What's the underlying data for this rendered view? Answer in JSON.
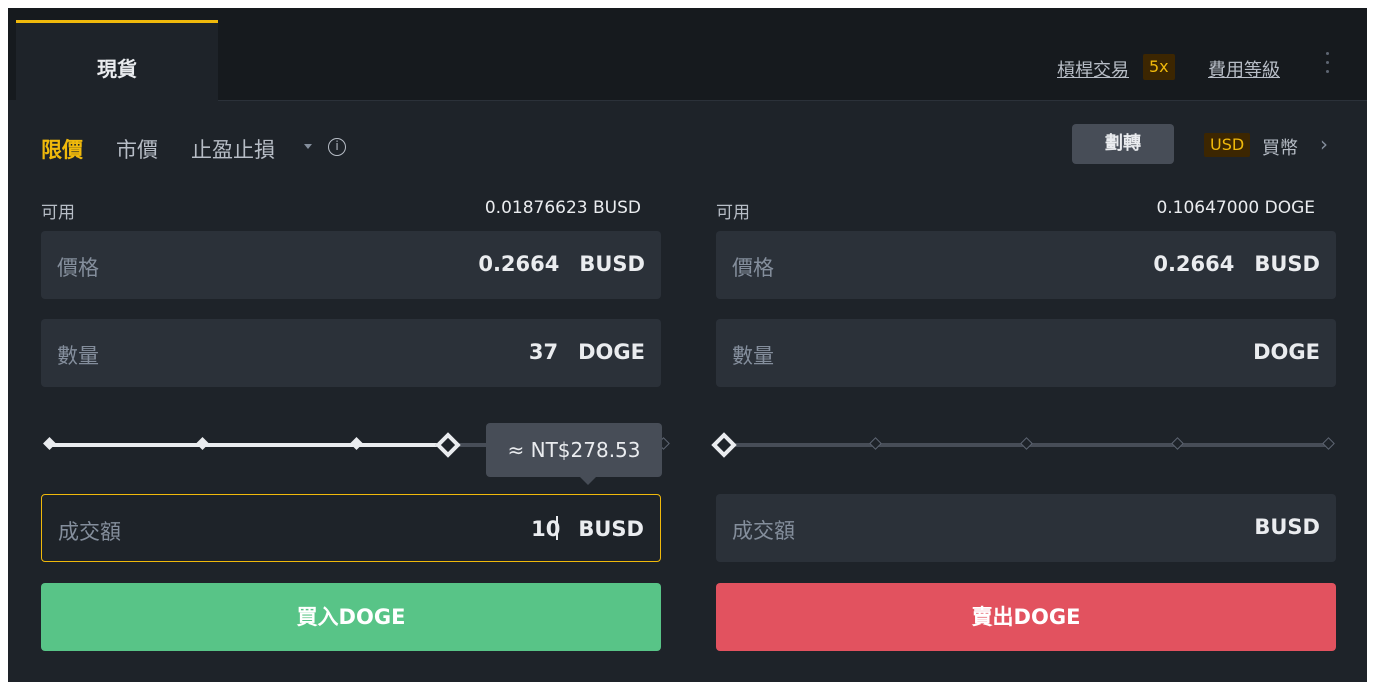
{
  "header": {
    "active_tab": "現貨",
    "margin_link": "槓桿交易",
    "margin_badge": "5x",
    "fee_link": "費用等級"
  },
  "order_types": {
    "limit": "限價",
    "market": "市價",
    "stop": "止盈止損"
  },
  "toolbar": {
    "transfer": "劃轉",
    "currency_badge": "USD",
    "buy_coin": "買幣",
    "chevron": "›"
  },
  "buy": {
    "available_label": "可用",
    "available_value": "0.01876623 BUSD",
    "price_label": "價格",
    "price_value": "0.2664",
    "price_unit": "BUSD",
    "amount_label": "數量",
    "amount_value": "37",
    "amount_unit": "DOGE",
    "slider_percent": 65,
    "tooltip": "≈ NT$278.53",
    "total_label": "成交額",
    "total_value": "10",
    "total_unit": "BUSD",
    "button": "買入DOGE"
  },
  "sell": {
    "available_label": "可用",
    "available_value": "0.10647000 DOGE",
    "price_label": "價格",
    "price_value": "0.2664",
    "price_unit": "BUSD",
    "amount_label": "數量",
    "amount_value": "",
    "amount_unit": "DOGE",
    "slider_percent": 0,
    "total_label": "成交額",
    "total_value": "",
    "total_unit": "BUSD",
    "button": "賣出DOGE"
  },
  "colors": {
    "accent": "#f0b90b",
    "buy": "#58c487",
    "sell": "#e2525f",
    "panel": "#1e2329",
    "field": "#2b3139"
  }
}
